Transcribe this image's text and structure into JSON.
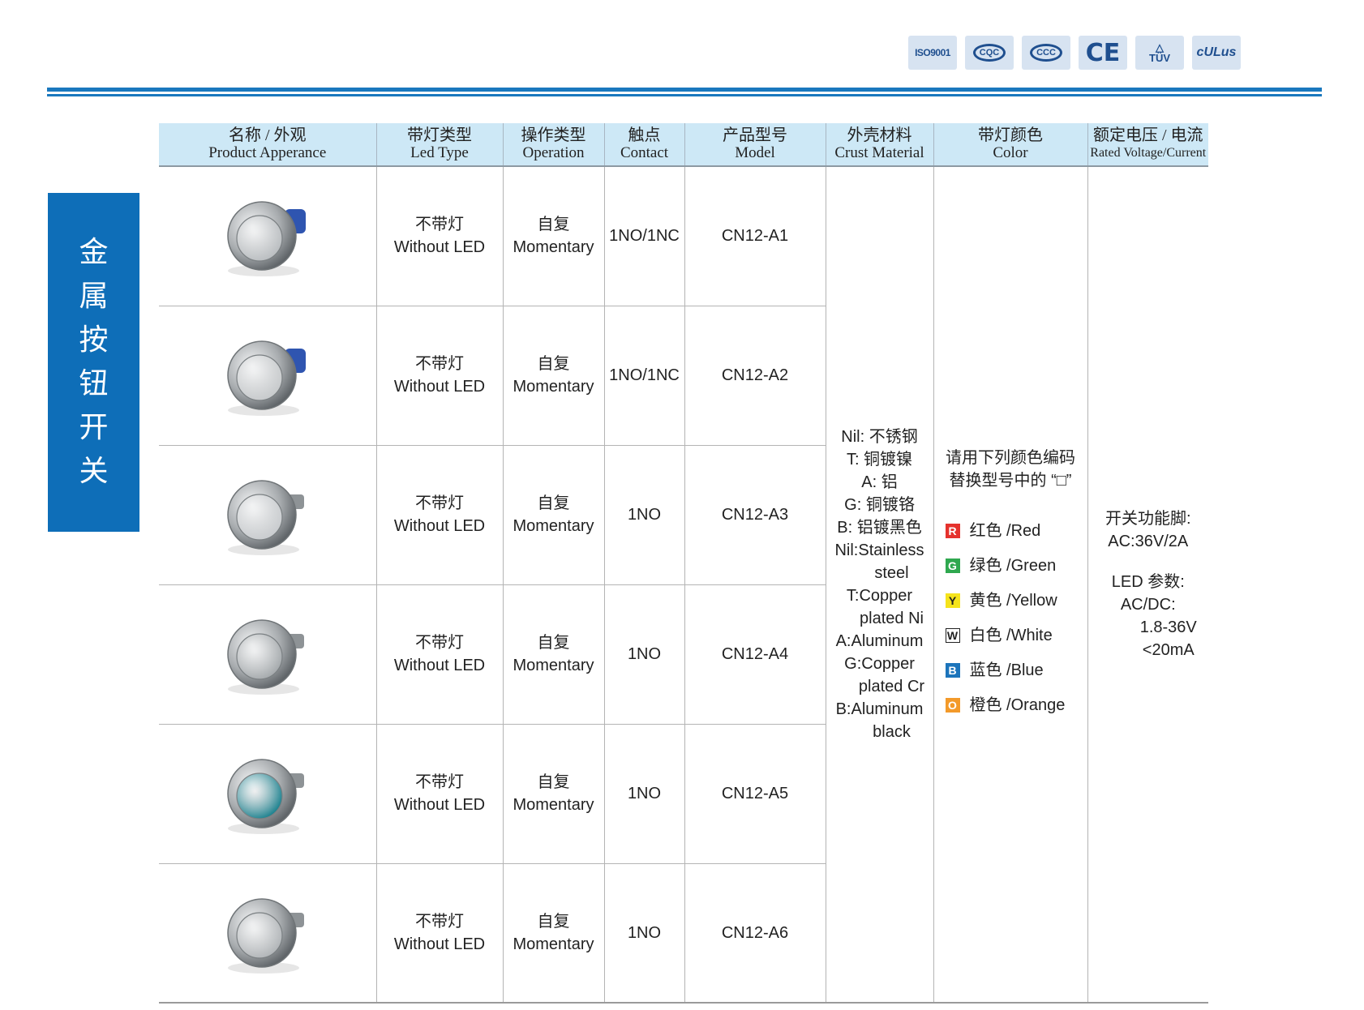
{
  "certifications": [
    {
      "name": "iso9001-logo",
      "text": "ISO9001"
    },
    {
      "name": "cqc-logo",
      "text": "CQC"
    },
    {
      "name": "ccc-logo",
      "text": "CCC"
    },
    {
      "name": "ce-logo",
      "text": "CE"
    },
    {
      "name": "tuv-logo",
      "text": "TÜV"
    },
    {
      "name": "cul-logo",
      "text": "cULus"
    }
  ],
  "side_title": [
    "金",
    "属",
    "按",
    "钮",
    "开",
    "关"
  ],
  "headers": [
    {
      "cn": "名称 / 外观",
      "en": "Product Apperance"
    },
    {
      "cn": "带灯类型",
      "en": "Led Type"
    },
    {
      "cn": "操作类型",
      "en": "Operation"
    },
    {
      "cn": "触点",
      "en": "Contact"
    },
    {
      "cn": "产品型号",
      "en": "Model"
    },
    {
      "cn": "外壳材料",
      "en": "Crust Material"
    },
    {
      "cn": "带灯颜色",
      "en": "Color"
    },
    {
      "cn": "额定电压 / 电流",
      "en": "Rated Voltage/Current"
    }
  ],
  "rows": [
    {
      "led_cn": "不带灯",
      "led_en": "Without LED",
      "op_cn": "自复",
      "op_en": "Momentary",
      "contact": "1NO/1NC",
      "model": "CN12-A1",
      "image": "metal-pushbutton-domed",
      "cap_color": "#b9bdc0"
    },
    {
      "led_cn": "不带灯",
      "led_en": "Without LED",
      "op_cn": "自复",
      "op_en": "Momentary",
      "contact": "1NO/1NC",
      "model": "CN12-A2",
      "image": "metal-pushbutton-flat",
      "cap_color": "#c7cacc"
    },
    {
      "led_cn": "不带灯",
      "led_en": "Without LED",
      "op_cn": "自复",
      "op_en": "Momentary",
      "contact": "1NO",
      "model": "CN12-A3",
      "image": "metal-pushbutton-flat-ring",
      "cap_color": "#c9cccf"
    },
    {
      "led_cn": "不带灯",
      "led_en": "Without LED",
      "op_cn": "自复",
      "op_en": "Momentary",
      "contact": "1NO",
      "model": "CN12-A4",
      "image": "metal-pushbutton-recessed",
      "cap_color": "#a3a8ab"
    },
    {
      "led_cn": "不带灯",
      "led_en": "Without LED",
      "op_cn": "自复",
      "op_en": "Momentary",
      "contact": "1NO",
      "model": "CN12-A5",
      "image": "metal-pushbutton-teal-cap",
      "cap_color": "#137e8c"
    },
    {
      "led_cn": "不带灯",
      "led_en": "Without LED",
      "op_cn": "自复",
      "op_en": "Momentary",
      "contact": "1NO",
      "model": "CN12-A6",
      "image": "metal-pushbutton-domed-high",
      "cap_color": "#b0b4b7"
    }
  ],
  "material": {
    "lines": [
      "Nil: 不锈钢",
      "T: 铜镀镍",
      "A: 铝",
      "G: 铜镀铬",
      "B: 铝镀黑色",
      "Nil:Stainless",
      "steel",
      "T:Copper",
      "plated Ni",
      "A:Aluminum",
      "G:Copper",
      "plated Cr",
      "B:Aluminum",
      "black"
    ]
  },
  "color": {
    "intro_1": "请用下列颜色编码",
    "intro_2": "替换型号中的 “□”",
    "items": [
      {
        "code": "R",
        "label": "红色 /Red",
        "box_color": "#e5322d",
        "text_color": "#ffffff"
      },
      {
        "code": "G",
        "label": "绿色 /Green",
        "box_color": "#2fa84f",
        "text_color": "#ffffff"
      },
      {
        "code": "Y",
        "label": "黄色 /Yellow",
        "box_color": "#f5e31c",
        "text_color": "#222222"
      },
      {
        "code": "W",
        "label": "白色 /White",
        "box_color": "#ffffff",
        "text_color": "#222222"
      },
      {
        "code": "B",
        "label": "蓝色 /Blue",
        "box_color": "#1c74bb",
        "text_color": "#ffffff"
      },
      {
        "code": "O",
        "label": "橙色 /Orange",
        "box_color": "#f39a2a",
        "text_color": "#ffffff"
      }
    ]
  },
  "rating": {
    "switch_label": "开关功能脚:",
    "switch_value": "AC:36V/2A",
    "led_label": "LED 参数:",
    "led_type": "AC/DC:",
    "led_voltage": "1.8-36V",
    "led_current": "<20mA"
  }
}
